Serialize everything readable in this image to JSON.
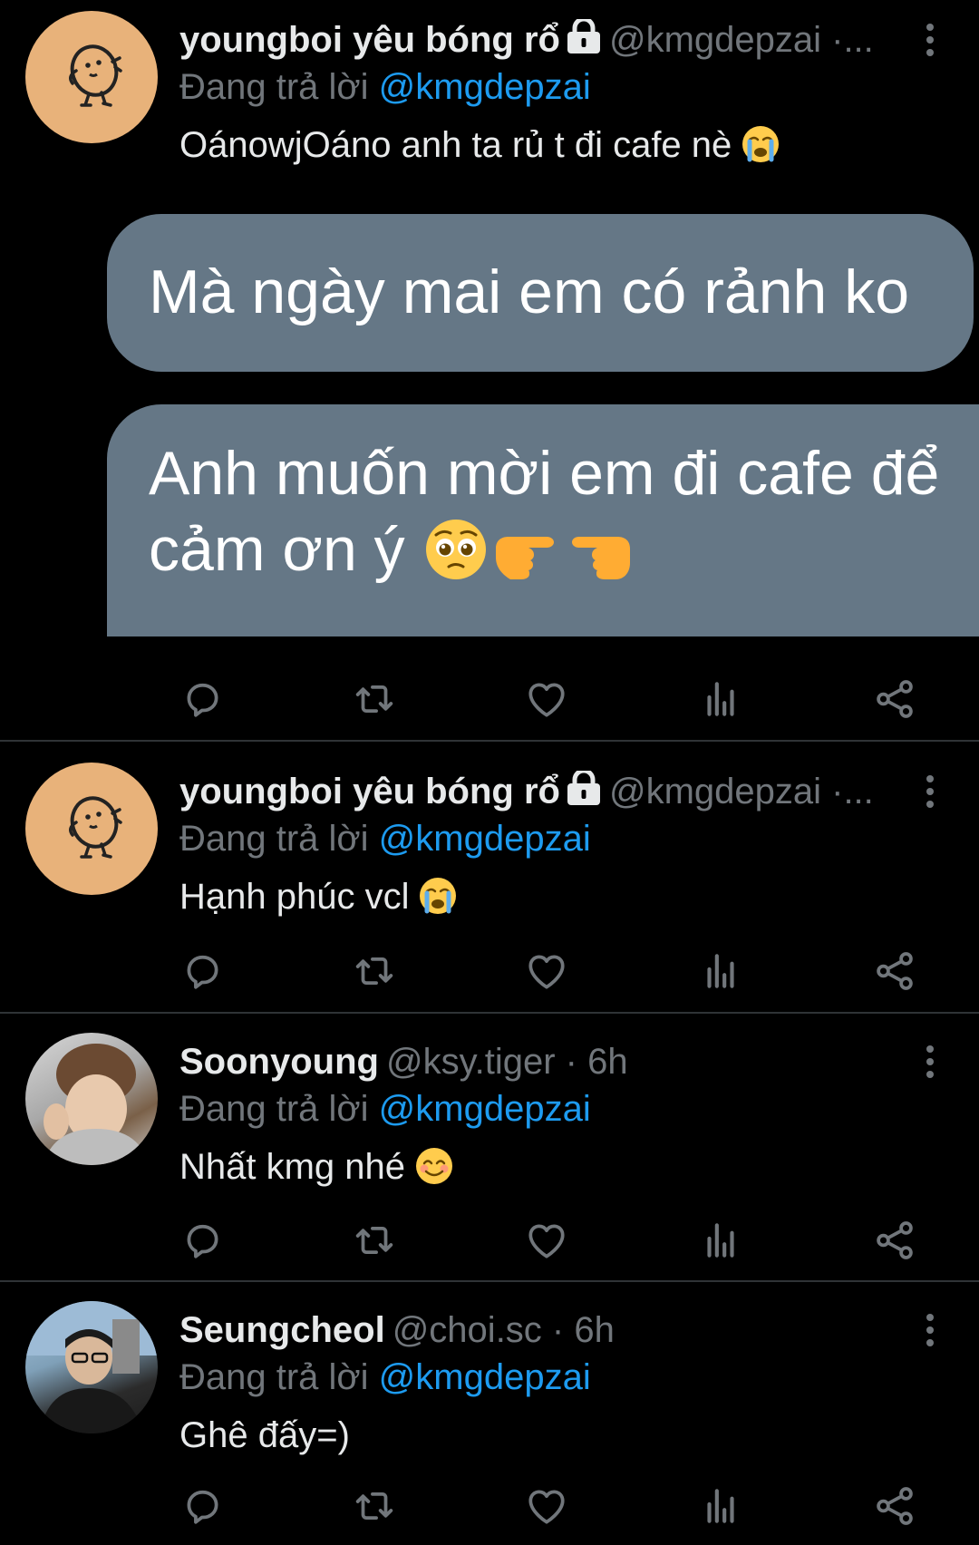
{
  "tweets": [
    {
      "name": "youngboi yêu bóng rổ",
      "handle": "@kmgdepzai ·...",
      "replying_prefix": "Đang trả lời",
      "replying_to": "@kmgdepzai",
      "text": "OánowjOáno anh ta rủ t đi cafe nè",
      "emoji": "loudly-crying-face",
      "attachment_lines": [
        "Mà ngày mai em có rảnh ko",
        "Anh muốn mời em đi cafe để",
        "cảm ơn ý"
      ]
    },
    {
      "name": "youngboi yêu bóng rổ",
      "handle": "@kmgdepzai ·...",
      "replying_prefix": "Đang trả lời",
      "replying_to": "@kmgdepzai",
      "text": "Hạnh phúc vcl",
      "emoji": "loudly-crying-face"
    },
    {
      "name": "Soonyoung",
      "handle": "@ksy.tiger · 6h",
      "replying_prefix": "Đang trả lời",
      "replying_to": "@kmgdepzai",
      "text": "Nhất kmg nhé",
      "emoji": "smiling-face"
    },
    {
      "name": "Seungcheol",
      "handle": "@choi.sc · 6h",
      "replying_prefix": "Đang trả lời",
      "replying_to": "@kmgdepzai",
      "text": "Ghê đấy=)"
    }
  ],
  "action_icons": [
    "reply-icon",
    "retweet-icon",
    "like-icon",
    "views-icon",
    "share-icon"
  ],
  "colors": {
    "background": "#000000",
    "text": "#e7e9ea",
    "secondary": "#71767b",
    "mention": "#1d9bf0",
    "divider": "#2f3336",
    "bubble": "#657786"
  }
}
